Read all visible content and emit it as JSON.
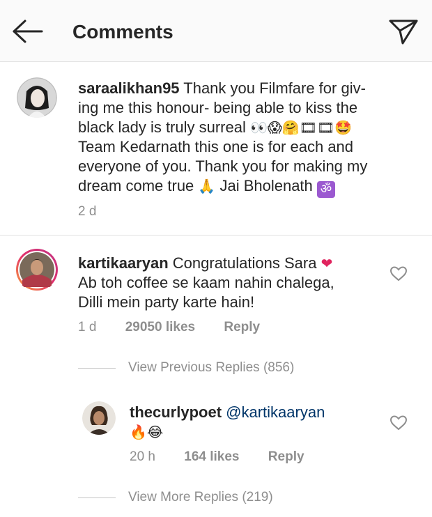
{
  "header": {
    "title": "Comments"
  },
  "caption": {
    "username": "saraalikhan95",
    "text_line1": "Thank you Filmfare for giv-",
    "text_line2": "ing me this honour- being able to kiss the",
    "text_line3_a": "black lady is truly surreal",
    "text_line3_emoji": "👀😱🤗🎞🎞🤩",
    "text_line4": "Team Kedarnath this one is for each and",
    "text_line5": "everyone of you. Thank you for making my",
    "text_line6_a": "dream come true",
    "text_line6_emoji": "🙏",
    "text_line6_b": "Jai Bholenath",
    "text_line6_om": "ॐ",
    "time": "2 d"
  },
  "comment": {
    "username": "kartikaaryan",
    "text_line1": "Congratulations Sara",
    "text_line1_emoji": "❤",
    "text_line2": "Ab toh coffee se kaam nahin chalega,",
    "text_line3": "Dilli mein party karte hain!",
    "time": "1 d",
    "likes": "29050 likes",
    "reply": "Reply"
  },
  "view_previous": "View Previous Replies (856)",
  "reply": {
    "username": "thecurlypoet",
    "mention": "@kartikaaryan",
    "emoji": "🔥😂",
    "time": "20 h",
    "likes": "164 likes",
    "reply": "Reply"
  },
  "view_more": "View More Replies (219)",
  "colors": {
    "text": "#262626",
    "meta": "#8e8e8e",
    "mention": "#003569",
    "heart": "#e0245e",
    "story_ring": "#e1306c"
  },
  "icons": {
    "back": "back-arrow-icon",
    "send": "direct-send-icon",
    "like": "heart-outline-icon"
  }
}
